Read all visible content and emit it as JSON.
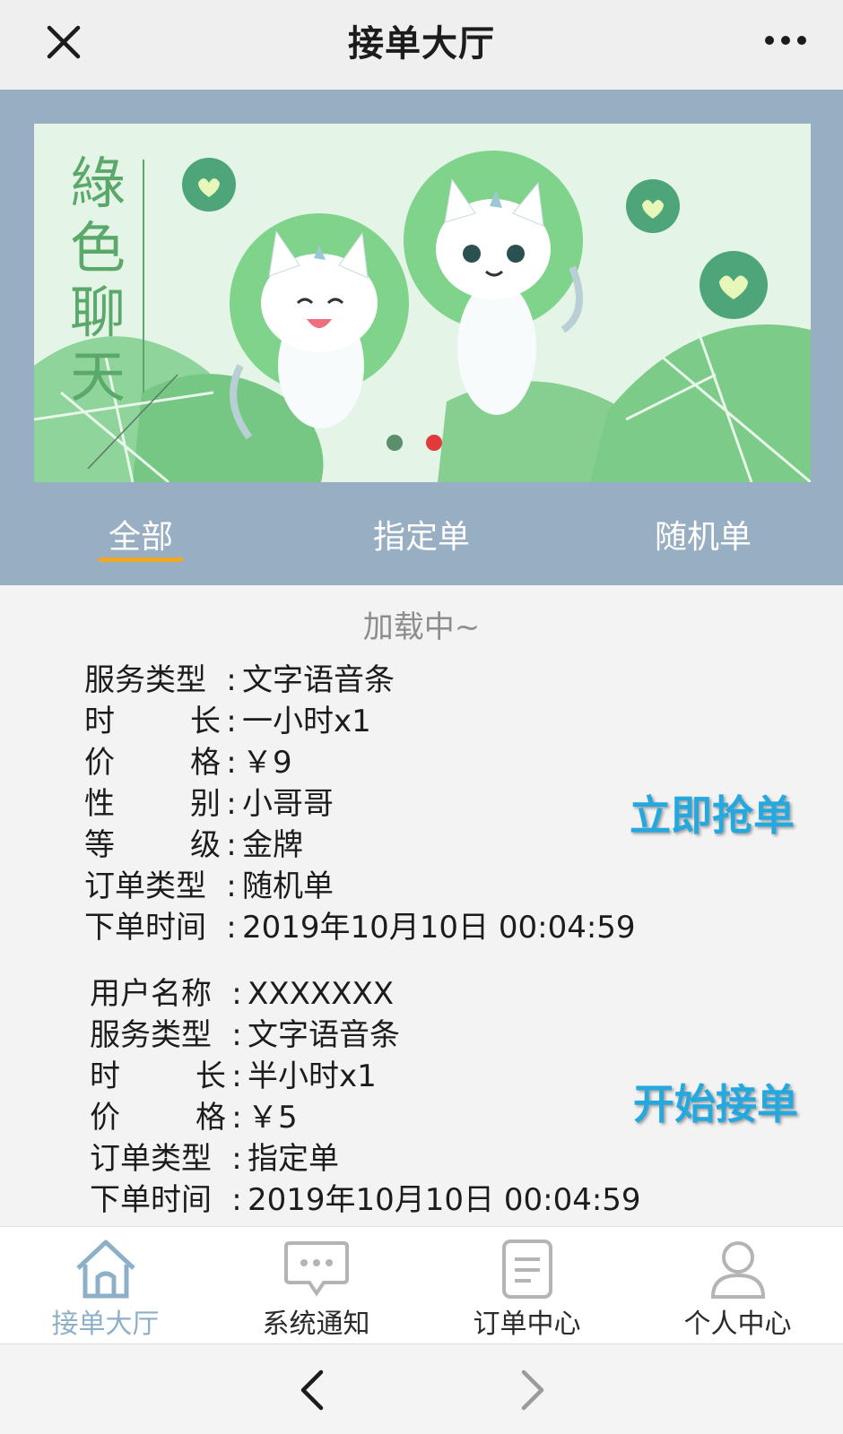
{
  "window": {
    "title": "接单大厅"
  },
  "icons": {
    "close": "close-icon",
    "more": "more-icon",
    "home": "home-icon",
    "message": "message-icon",
    "document": "document-icon",
    "user": "user-icon",
    "back": "back-icon",
    "forward": "forward-icon"
  },
  "banner": {
    "text": "綠色聊天",
    "active_slide": 2,
    "slide_count": 2
  },
  "filter_tabs": [
    {
      "label": "全部",
      "active": true
    },
    {
      "label": "指定单",
      "active": false
    },
    {
      "label": "随机单",
      "active": false
    }
  ],
  "loading_text": "加载中~",
  "orders": [
    {
      "fields": [
        {
          "label": "服务类型",
          "value": "文字语音条"
        },
        {
          "label": "时长",
          "value": "一小时x1"
        },
        {
          "label": "价格",
          "value": "￥9"
        },
        {
          "label": "性别",
          "value": "小哥哥"
        },
        {
          "label": "等级",
          "value": "金牌"
        },
        {
          "label": "订单类型",
          "value": "随机单"
        },
        {
          "label": "下单时间",
          "value": "2019年10月10日 00:04:59"
        }
      ],
      "action_label": "立即抢单"
    },
    {
      "fields": [
        {
          "label": "用户名称",
          "value": "XXXXXXX"
        },
        {
          "label": "服务类型",
          "value": "文字语音条"
        },
        {
          "label": "时长",
          "value": "半小时x1"
        },
        {
          "label": "价格",
          "value": "￥5"
        },
        {
          "label": "订单类型",
          "value": "指定单"
        },
        {
          "label": "下单时间",
          "value": "2019年10月10日 00:04:59"
        }
      ],
      "action_label": "开始接单"
    }
  ],
  "bottom_nav": [
    {
      "label": "接单大厅",
      "icon": "home-icon",
      "active": true
    },
    {
      "label": "系统通知",
      "icon": "message-icon",
      "active": false
    },
    {
      "label": "订单中心",
      "icon": "document-icon",
      "active": false
    },
    {
      "label": "个人中心",
      "icon": "user-icon",
      "active": false
    }
  ],
  "colors": {
    "header_bg": "#97aec3",
    "tab_indicator": "#f0a926",
    "action_text": "#25a8de",
    "active_nav": "#8db0c8",
    "banner_green": "#7fd28a",
    "dot_active": "#e03a3a"
  }
}
